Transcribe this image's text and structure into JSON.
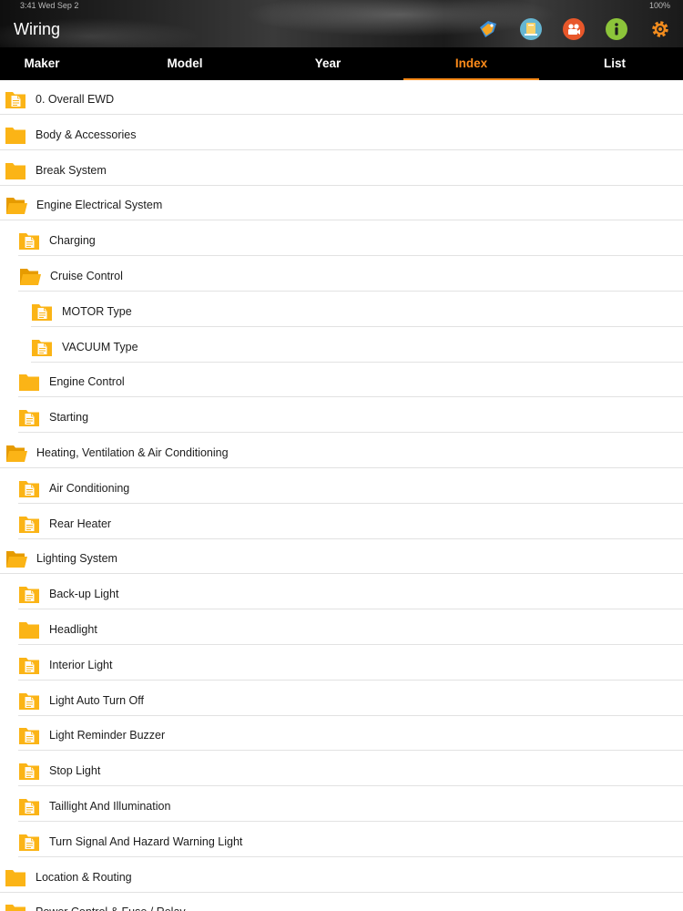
{
  "status_bar": {
    "left": "3:41   Wed Sep 2",
    "right": "100%"
  },
  "header": {
    "title": "Wiring",
    "icons": [
      {
        "name": "tag-icon",
        "color": "#3a8fd9"
      },
      {
        "name": "book-icon",
        "color": "#5fb3cf"
      },
      {
        "name": "video-camera-icon",
        "color": "#e8572a"
      },
      {
        "name": "info-icon",
        "color": "#8cc43a"
      },
      {
        "name": "settings-gear-icon",
        "color": "#f28c1e"
      }
    ]
  },
  "tabs": [
    {
      "label": "Maker",
      "active": false
    },
    {
      "label": "Model",
      "active": false
    },
    {
      "label": "Year",
      "active": false
    },
    {
      "label": "Index",
      "active": true
    },
    {
      "label": "List",
      "active": false
    }
  ],
  "colors": {
    "accent": "#ff8c1a",
    "folder": "#fbb416",
    "folder_dark": "#e69b00"
  },
  "items": [
    {
      "label": "0. Overall EWD",
      "level": 0,
      "icon": "document-folder-icon"
    },
    {
      "label": "Body & Accessories",
      "level": 0,
      "icon": "closed-folder-icon"
    },
    {
      "label": "Break System",
      "level": 0,
      "icon": "closed-folder-icon"
    },
    {
      "label": "Engine Electrical System",
      "level": 0,
      "icon": "open-folder-icon"
    },
    {
      "label": "Charging",
      "level": 1,
      "icon": "document-folder-icon"
    },
    {
      "label": "Cruise Control",
      "level": 1,
      "icon": "open-folder-icon"
    },
    {
      "label": "MOTOR Type",
      "level": 2,
      "icon": "document-folder-icon"
    },
    {
      "label": "VACUUM Type",
      "level": 2,
      "icon": "document-folder-icon"
    },
    {
      "label": "Engine Control",
      "level": 1,
      "icon": "closed-folder-icon"
    },
    {
      "label": "Starting",
      "level": 1,
      "icon": "document-folder-icon"
    },
    {
      "label": "Heating, Ventilation & Air Conditioning",
      "level": 0,
      "icon": "open-folder-icon"
    },
    {
      "label": "Air Conditioning",
      "level": 1,
      "icon": "document-folder-icon"
    },
    {
      "label": "Rear Heater",
      "level": 1,
      "icon": "document-folder-icon"
    },
    {
      "label": "Lighting System",
      "level": 0,
      "icon": "open-folder-icon"
    },
    {
      "label": "Back-up Light",
      "level": 1,
      "icon": "document-folder-icon"
    },
    {
      "label": "Headlight",
      "level": 1,
      "icon": "closed-folder-icon"
    },
    {
      "label": "Interior Light",
      "level": 1,
      "icon": "document-folder-icon"
    },
    {
      "label": "Light Auto Turn Off",
      "level": 1,
      "icon": "document-folder-icon"
    },
    {
      "label": "Light Reminder Buzzer",
      "level": 1,
      "icon": "document-folder-icon"
    },
    {
      "label": "Stop Light",
      "level": 1,
      "icon": "document-folder-icon"
    },
    {
      "label": "Taillight And Illumination",
      "level": 1,
      "icon": "document-folder-icon"
    },
    {
      "label": "Turn Signal And Hazard Warning Light",
      "level": 1,
      "icon": "document-folder-icon"
    },
    {
      "label": "Location & Routing",
      "level": 0,
      "icon": "closed-folder-icon"
    },
    {
      "label": "Power Control & Fuse / Relay",
      "level": 0,
      "icon": "closed-folder-icon"
    }
  ]
}
